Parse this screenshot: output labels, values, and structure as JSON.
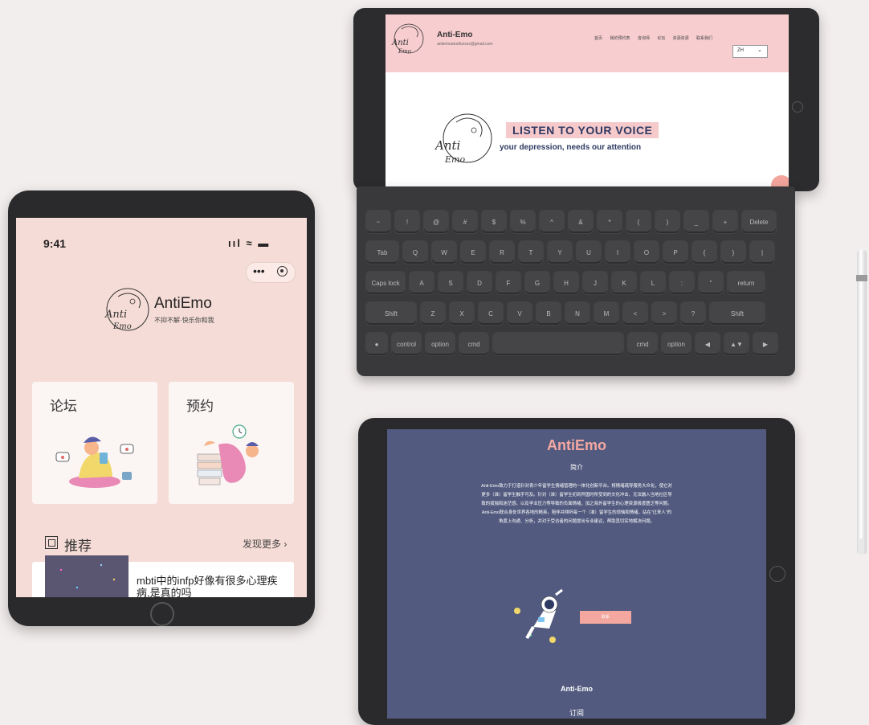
{
  "app": {
    "time": "9:41",
    "status_icons": "ııl ≈ ▬",
    "capsule_dots": "•••",
    "name": "AntiEmo",
    "slogan": "不抑不解·快乐你和我",
    "logo_text_1": "Anti",
    "logo_text_2": "Emo",
    "cards": [
      {
        "label": "论坛"
      },
      {
        "label": "预约"
      }
    ],
    "recommend_title": "推荐",
    "recommend_more": "发现更多 ›",
    "post_title": "mbti中的infp好像有很多心理疾病,是真的吗"
  },
  "website": {
    "name": "Anti-Emo",
    "email": "antiemoatuofuxxxx@gmail.com",
    "nav": [
      "首页",
      "我的预约表",
      "咨询师",
      "论坛",
      "资源资源",
      "联系我们"
    ],
    "lang": "ZH",
    "lang_chevron": "⌄",
    "hero_tag": "LISTEN TO YOUR VOICE",
    "hero_sub": "your depression, needs our attention"
  },
  "keyboard": {
    "row1": [
      "~",
      "!",
      "@",
      "#",
      "$",
      "%",
      "^",
      "&",
      "*",
      "(",
      ")",
      "_",
      "+",
      "Delete"
    ],
    "row2": [
      "Tab",
      "Q",
      "W",
      "E",
      "R",
      "T",
      "Y",
      "U",
      "I",
      "O",
      "P",
      "{",
      "}",
      "|"
    ],
    "row3": [
      "Caps lock",
      "A",
      "S",
      "D",
      "F",
      "G",
      "H",
      "J",
      "K",
      "L",
      ":",
      "\"",
      "return"
    ],
    "row4": [
      "Shift",
      "Z",
      "X",
      "C",
      "V",
      "B",
      "N",
      "M",
      "<",
      ">",
      "?",
      "Shift"
    ],
    "row5": [
      "●",
      "control",
      "option",
      "cmd",
      "",
      "cmd",
      "option",
      "◀",
      "▲▼",
      "▶"
    ]
  },
  "intro": {
    "title": "AntiEmo",
    "subtitle": "简介",
    "body": "Anti-Emo致力于打造针对青少年留学生情绪管理的一体化创新平台。将情绪疏导服务大众化，使它对更多（准）留学生触手可及。针对（准）留学生初到异国时所受到的文化冲击、无法融入当地社区导致的孤独和迷茫感，以及学业压力等导致的负面情绪，加之海外留学生的心理资源极度匮乏等问题。Anti-Emo联合身处世界各地的精英，陪伴并倾听每一个（准）留学生的烦恼和情绪，站在\"过来人\"的角度上沟通、分析，并对于受访者的问题提出专业建议，帮助其切实地解决问题。",
    "button": "联系",
    "footer": "Anti-Emo",
    "subscribe": "订阅"
  },
  "colors": {
    "accent_pink": "#f7cdd0",
    "navy": "#2f3a63",
    "intro_bg": "#525b7f",
    "app_bg": "#f6dcd6"
  }
}
